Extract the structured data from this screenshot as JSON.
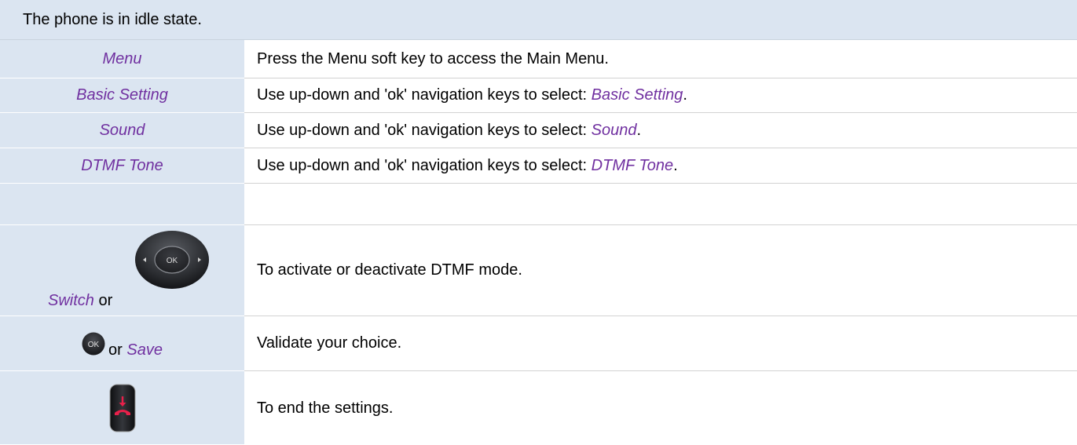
{
  "header": {
    "text": "The phone is in idle state."
  },
  "rows": [
    {
      "key": "Menu",
      "desc": "Press the Menu soft key to access the Main Menu."
    },
    {
      "key": "Basic Setting",
      "desc_prefix": "Use up-down and 'ok' navigation keys to select: ",
      "desc_em": "Basic Setting",
      "desc_suffix": "."
    },
    {
      "key": "Sound",
      "desc_prefix": "Use up-down and 'ok' navigation keys to select: ",
      "desc_em": "Sound",
      "desc_suffix": "."
    },
    {
      "key": "DTMF Tone",
      "desc_prefix": "Use up-down and 'ok' navigation keys to select: ",
      "desc_em": "DTMF Tone",
      "desc_suffix": "."
    },
    {
      "key": "",
      "desc": ""
    },
    {
      "key_em": "Switch",
      "key_or": " or",
      "icon": "navigation-ok-key-icon",
      "desc": "To activate or deactivate DTMF mode."
    },
    {
      "icon": "ok-key-icon",
      "key_or": " or ",
      "key_em": "Save",
      "desc": "Validate your choice."
    },
    {
      "icon": "hang-up-key-icon",
      "desc": "To end the settings."
    }
  ],
  "icons": {
    "ok_label": "OK"
  },
  "colors": {
    "header_bg": "#dbe5f1",
    "key_text": "#7030a0",
    "hangup_red": "#e8204a"
  }
}
